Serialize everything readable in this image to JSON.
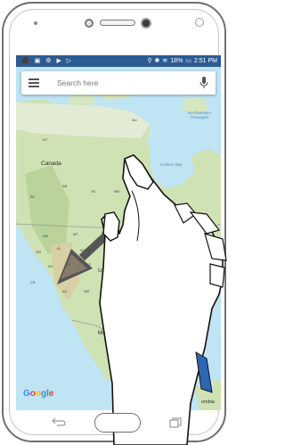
{
  "status_bar": {
    "battery": "18%",
    "time": "2:51 PM"
  },
  "search": {
    "placeholder": "Search here"
  },
  "map_labels": {
    "canada": "Canada",
    "hudson_bay": "Hudson Bay",
    "northwestern_passages": "Northwestern Passages",
    "united": "Unite",
    "mexico": "Mexico",
    "colombia": "ombia",
    "nu": "NU",
    "nt": "NT",
    "ab": "AB",
    "bc": "BC",
    "sk": "SK",
    "mb": "MB",
    "on": "ON",
    "wa": "WA",
    "mt": "MT",
    "nd": "ND",
    "or": "OR",
    "id": "ID",
    "wy": "WY",
    "nv": "NV",
    "ut": "UT",
    "co": "CO",
    "ca": "CA",
    "az": "AZ",
    "nm": "NM",
    "tx": "TX"
  },
  "branding": {
    "google": "Google"
  },
  "icons": {
    "menu": "menu-icon",
    "mic": "mic-icon",
    "back": "back-icon",
    "recent": "recent-apps-icon"
  },
  "colors": {
    "status_bar": "#2c5b94",
    "water": "#bfe4f4",
    "land": "#cfe2b4",
    "arrow": "#555555"
  }
}
